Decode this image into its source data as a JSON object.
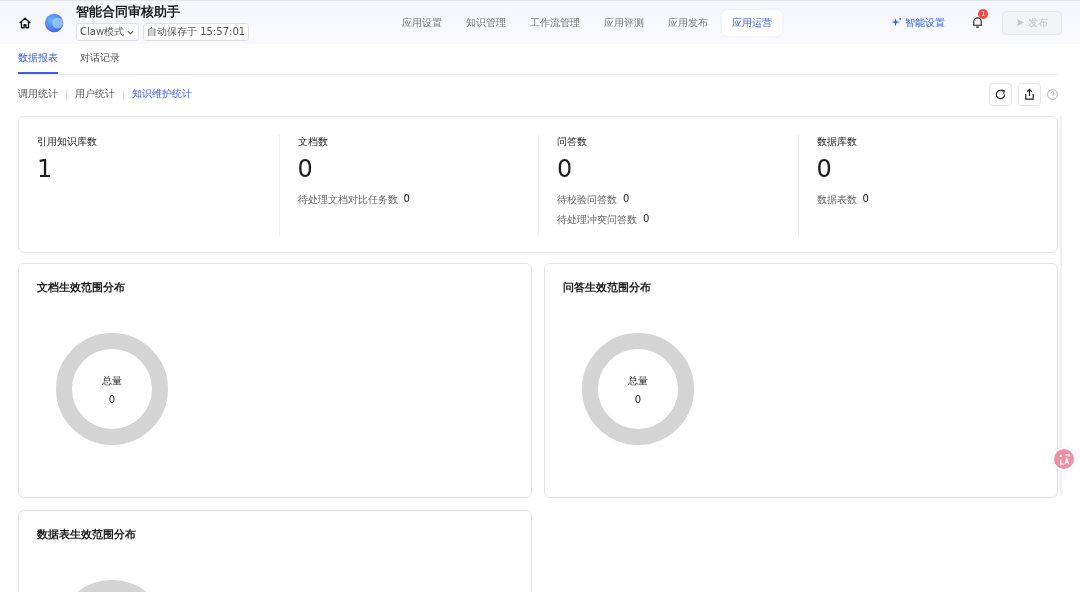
{
  "header": {
    "app_name": "智能合同审核助手",
    "mode": "Claw模式",
    "autosave": "自动保存于 15:57:01",
    "nav": [
      {
        "label": "应用设置",
        "selected": false
      },
      {
        "label": "知识管理",
        "selected": false
      },
      {
        "label": "工作流管理",
        "selected": false
      },
      {
        "label": "应用评测",
        "selected": false
      },
      {
        "label": "应用发布",
        "selected": false
      },
      {
        "label": "应用运营",
        "selected": true
      }
    ],
    "smart_settings": "智能设置",
    "notification_count": "1",
    "publish": {
      "label": "发布",
      "disabled": true
    }
  },
  "tabs": [
    {
      "label": "数据报表",
      "selected": true
    },
    {
      "label": "对话记录",
      "selected": false
    }
  ],
  "sub_tabs": [
    {
      "label": "调用统计",
      "selected": false
    },
    {
      "label": "用户统计",
      "selected": false
    },
    {
      "label": "知识维护统计",
      "selected": true
    }
  ],
  "stats": [
    {
      "title": "引用知识库数",
      "value": "1"
    },
    {
      "title": "文档数",
      "value": "0",
      "details": [
        {
          "label": "待处理文档对比任务数",
          "value": "0"
        }
      ]
    },
    {
      "title": "问答数",
      "value": "0",
      "details": [
        {
          "label": "待校验问答数",
          "value": "0"
        },
        {
          "label": "待处理冲突问答数",
          "value": "0"
        }
      ]
    },
    {
      "title": "数据库数",
      "value": "0",
      "details": [
        {
          "label": "数据表数",
          "value": "0"
        }
      ]
    }
  ],
  "distributions": [
    {
      "title": "文档生效范围分布",
      "center_label": "总量",
      "center_value": "0"
    },
    {
      "title": "问答生效范围分布",
      "center_label": "总量",
      "center_value": "0"
    },
    {
      "title": "数据表生效范围分布"
    }
  ]
}
